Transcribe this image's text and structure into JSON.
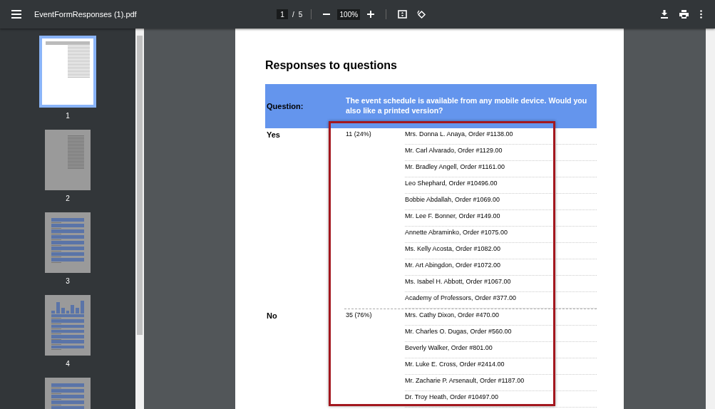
{
  "toolbar": {
    "file_name": "EventFormResponses (1).pdf",
    "page_current": "1",
    "page_separator": "/",
    "page_total": "5",
    "zoom": "100%"
  },
  "thumbnails": [
    {
      "label": "1",
      "selected": true,
      "kind": "list"
    },
    {
      "label": "2",
      "selected": false,
      "kind": "list"
    },
    {
      "label": "3",
      "selected": false,
      "kind": "form"
    },
    {
      "label": "4",
      "selected": false,
      "kind": "chart"
    },
    {
      "selected": false,
      "kind": "form"
    }
  ],
  "document": {
    "title": "Responses to questions",
    "question_label": "Question:",
    "question_text": "The event schedule is available from any mobile device. Would you also like a printed version?",
    "answers": [
      {
        "answer": "Yes",
        "count": "11 (24%)",
        "respondents": [
          "Mrs. Donna L. Anaya, Order #1138.00",
          "Mr. Carl Alvarado, Order #1129.00",
          "Mr. Bradley Angell, Order #1161.00",
          "Leo Shephard, Order #10496.00",
          "Bobbie Abdallah, Order #1069.00",
          "Mr. Lee F. Bonner, Order #149.00",
          "Annette Abraminko, Order #1075.00",
          "Ms. Kelly Acosta, Order #1082.00",
          "Mr. Art Abingdon, Order #1072.00",
          "Ms. Isabel H. Abbott, Order #1067.00",
          "Academy of Professors, Order #377.00"
        ]
      },
      {
        "answer": "No",
        "count": "35 (76%)",
        "respondents": [
          "Mrs. Cathy Dixon, Order #470.00",
          "Mr. Charles O. Dugas, Order #560.00",
          "Beverly Walker, Order #801.00",
          "Mr. Luke E. Cross, Order #2414.00",
          "Mr. Zacharie P. Arsenault, Order #1187.00",
          "Dr. Troy Heath, Order #10497.00"
        ]
      }
    ]
  }
}
